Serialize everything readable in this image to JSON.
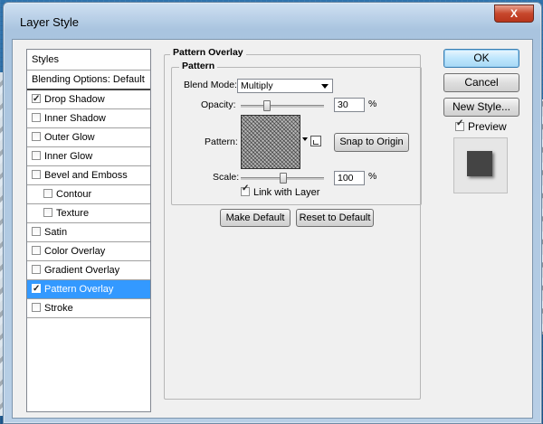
{
  "window": {
    "title": "Layer Style",
    "close_label": "X"
  },
  "styles_panel": {
    "header": "Styles",
    "items": [
      {
        "label": "Blending Options: Default",
        "has_checkbox": false,
        "checked": false,
        "indent": false,
        "selected": false
      },
      {
        "label": "Drop Shadow",
        "has_checkbox": true,
        "checked": true,
        "indent": false,
        "selected": false
      },
      {
        "label": "Inner Shadow",
        "has_checkbox": true,
        "checked": false,
        "indent": false,
        "selected": false
      },
      {
        "label": "Outer Glow",
        "has_checkbox": true,
        "checked": false,
        "indent": false,
        "selected": false
      },
      {
        "label": "Inner Glow",
        "has_checkbox": true,
        "checked": false,
        "indent": false,
        "selected": false
      },
      {
        "label": "Bevel and Emboss",
        "has_checkbox": true,
        "checked": false,
        "indent": false,
        "selected": false
      },
      {
        "label": "Contour",
        "has_checkbox": true,
        "checked": false,
        "indent": true,
        "selected": false
      },
      {
        "label": "Texture",
        "has_checkbox": true,
        "checked": false,
        "indent": true,
        "selected": false
      },
      {
        "label": "Satin",
        "has_checkbox": true,
        "checked": false,
        "indent": false,
        "selected": false
      },
      {
        "label": "Color Overlay",
        "has_checkbox": true,
        "checked": false,
        "indent": false,
        "selected": false
      },
      {
        "label": "Gradient Overlay",
        "has_checkbox": true,
        "checked": false,
        "indent": false,
        "selected": false
      },
      {
        "label": "Pattern Overlay",
        "has_checkbox": true,
        "checked": true,
        "indent": false,
        "selected": true
      },
      {
        "label": "Stroke",
        "has_checkbox": true,
        "checked": false,
        "indent": false,
        "selected": false
      }
    ]
  },
  "pattern_overlay": {
    "section_title": "Pattern Overlay",
    "subsection_title": "Pattern",
    "blend_mode_label": "Blend Mode:",
    "blend_mode_value": "Multiply",
    "opacity_label": "Opacity:",
    "opacity_value": "30",
    "opacity_unit": "%",
    "opacity_fraction": 0.3,
    "pattern_label": "Pattern:",
    "snap_to_origin_label": "Snap to Origin",
    "scale_label": "Scale:",
    "scale_value": "100",
    "scale_unit": "%",
    "scale_fraction": 0.5,
    "link_with_layer_label": "Link with Layer",
    "link_with_layer_checked": true,
    "make_default_label": "Make Default",
    "reset_to_default_label": "Reset to Default"
  },
  "actions": {
    "ok_label": "OK",
    "cancel_label": "Cancel",
    "new_style_label": "New Style...",
    "preview_label": "Preview",
    "preview_checked": true
  },
  "colors": {
    "selection": "#3399ff",
    "close_button": "#c7472c",
    "preview_swatch": "#444444"
  }
}
